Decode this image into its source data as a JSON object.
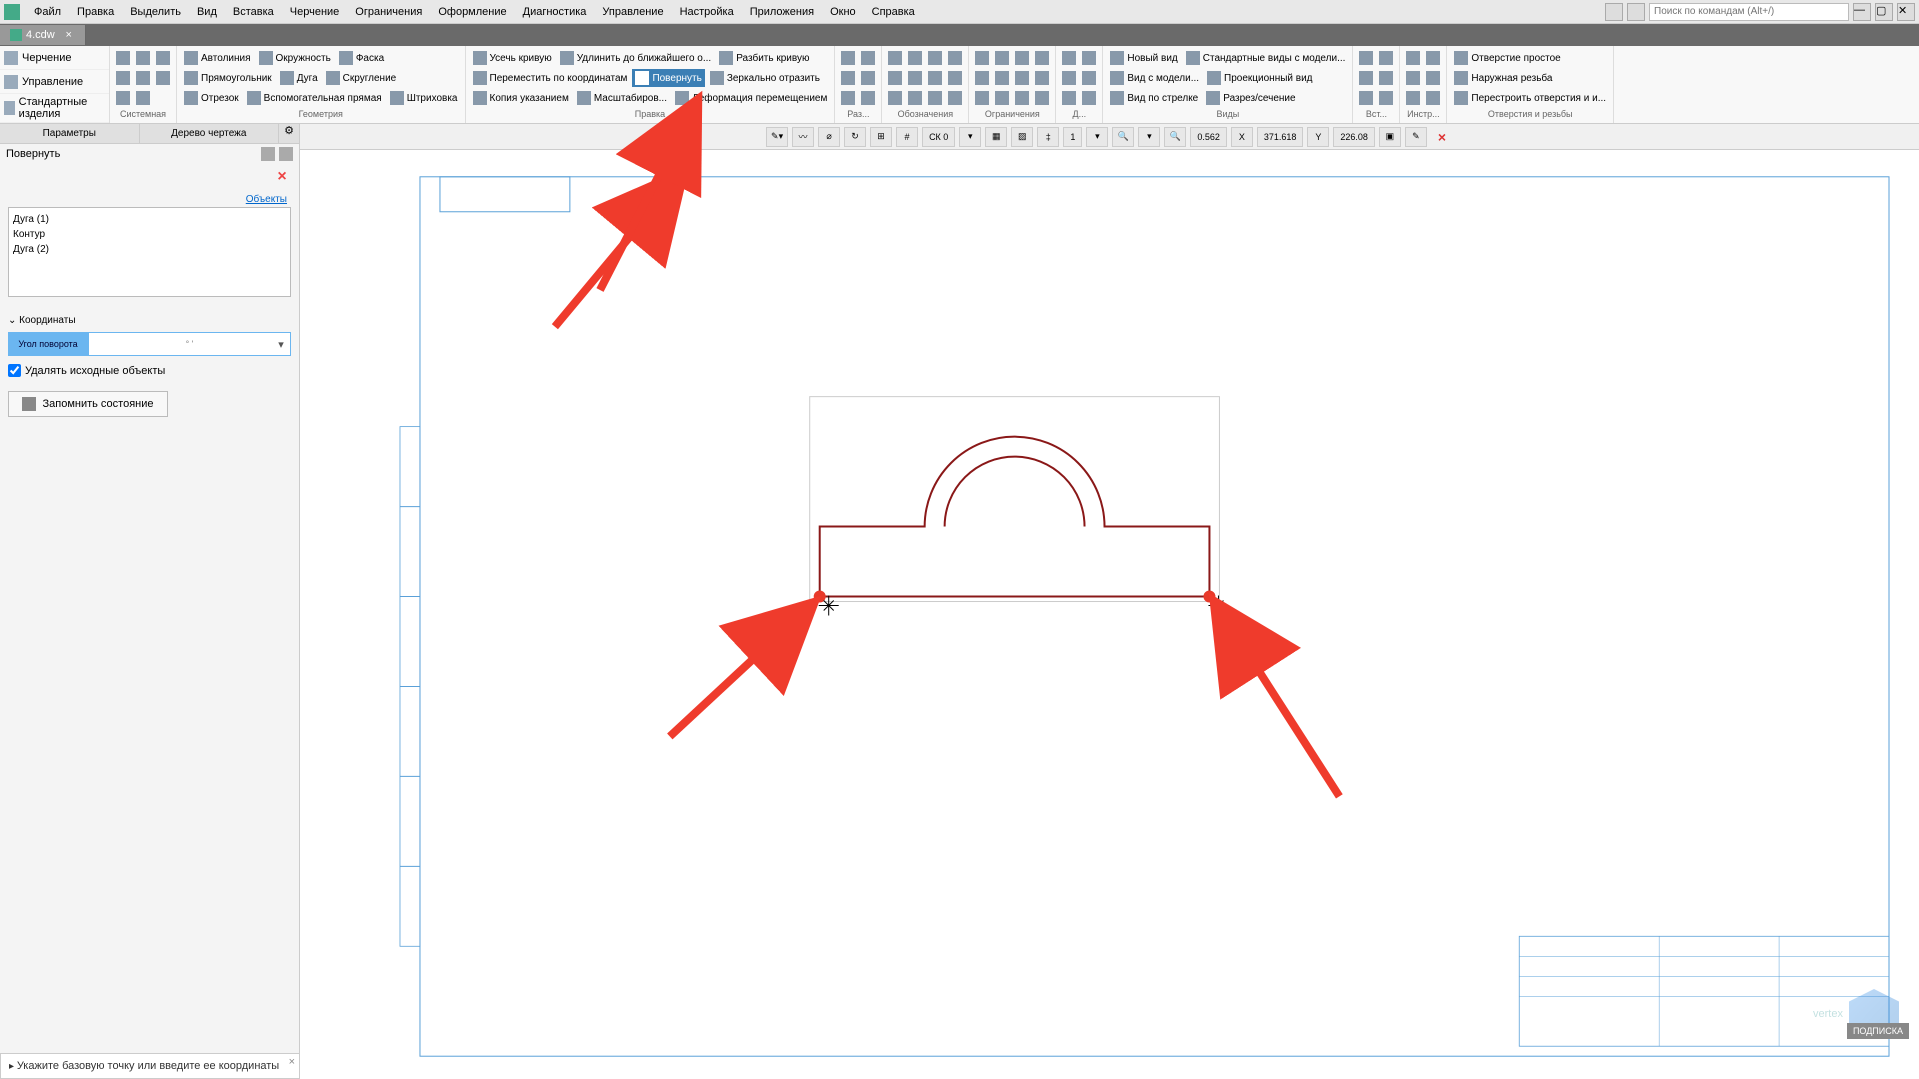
{
  "menu": {
    "items": [
      "Файл",
      "Правка",
      "Выделить",
      "Вид",
      "Вставка",
      "Черчение",
      "Ограничения",
      "Оформление",
      "Диагностика",
      "Управление",
      "Настройка",
      "Приложения",
      "Окно",
      "Справка"
    ],
    "search_placeholder": "Поиск по командам (Alt+/)"
  },
  "doc_tab": {
    "name": "4.cdw"
  },
  "side_stack": [
    "Черчение",
    "Управление",
    "Стандартные изделия"
  ],
  "ribbon": {
    "sys": {
      "label": "Системная"
    },
    "geom": {
      "label": "Геометрия",
      "autoline": "Автолиния",
      "circle": "Окружность",
      "chamfer": "Фаска",
      "rect": "Прямоугольник",
      "arc": "Дуга",
      "fillet": "Скругление",
      "line": "Отрезок",
      "aux": "Вспомогательная прямая",
      "hatch": "Штриховка"
    },
    "edit": {
      "label": "Правка",
      "trim": "Усечь кривую",
      "extend": "Удлинить до ближайшего о...",
      "split": "Разбить кривую",
      "move": "Переместить по координатам",
      "rotate": "Повернуть",
      "mirror": "Зеркально отразить",
      "copy": "Копия указанием",
      "scale": "Масштабиров...",
      "deform": "Деформация перемещением"
    },
    "dim": {
      "label": "Раз..."
    },
    "annot": {
      "label": "Обозначения"
    },
    "constr": {
      "label": "Ограничения"
    },
    "diag": {
      "label": "Д..."
    },
    "views": {
      "label": "Виды",
      "newview": "Новый вид",
      "modelview": "Вид с модели...",
      "arrowview": "Вид по стрелке",
      "stdviews": "Стандартные виды с модели...",
      "projview": "Проекционный вид",
      "section": "Разрез/сечение"
    },
    "ins": {
      "label": "Вст..."
    },
    "tools": {
      "label": "Инстр..."
    },
    "holes": {
      "label": "Отверстия и резьбы",
      "simple": "Отверстие простое",
      "ext_thread": "Наружная резьба",
      "rebuild": "Перестроить отверстия и и..."
    }
  },
  "left_panel": {
    "tabs": [
      "Параметры",
      "Дерево чертежа"
    ],
    "command": "Повернуть",
    "objects_label": "Объекты",
    "objects": [
      "Дуга (1)",
      "Контур",
      "Дуга (2)"
    ],
    "coord_header": "Координаты",
    "angle_label": "Угол поворота",
    "angle_marks": "°        '",
    "delete_src": "Удалять исходные объекты",
    "remember": "Запомнить состояние"
  },
  "canvas_bar": {
    "cs": "СК 0",
    "scale": "1",
    "zoom": "0.562",
    "x_lbl": "X",
    "x": "371.618",
    "y_lbl": "Y",
    "y": "226.08"
  },
  "status": {
    "msg": "Укажите базовую точку или введите ее координаты"
  },
  "watermark": {
    "brand": "vertex",
    "badge": "ПОДПИСКА"
  }
}
